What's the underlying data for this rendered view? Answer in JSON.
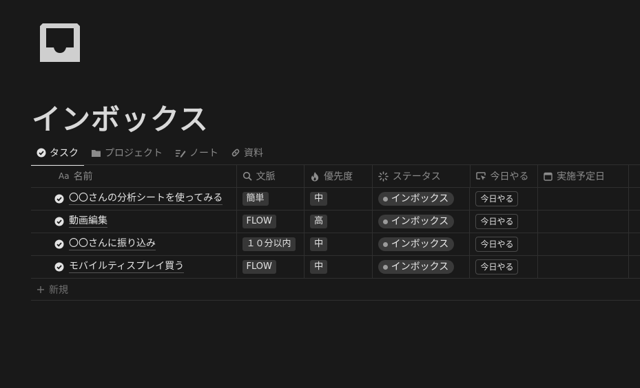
{
  "page": {
    "icon": "inbox-tray-icon",
    "title": "インボックス"
  },
  "tabs": [
    {
      "label": "タスク",
      "icon": "check-circle-icon",
      "active": true
    },
    {
      "label": "プロジェクト",
      "icon": "folder-icon",
      "active": false
    },
    {
      "label": "ノート",
      "icon": "note-pen-icon",
      "active": false
    },
    {
      "label": "資料",
      "icon": "link-icon",
      "active": false
    }
  ],
  "table": {
    "headers": {
      "name_prefix": "Aa",
      "name": "名前",
      "bunmyaku": "文脈",
      "priority": "優先度",
      "status": "ステータス",
      "today": "今日やる",
      "date": "実施予定日"
    },
    "rows": [
      {
        "name": "〇〇さんの分析シートを使ってみる",
        "bunmyaku": "簡単",
        "priority": "中",
        "status": "インボックス",
        "today": "今日やる",
        "date": ""
      },
      {
        "name": "動画編集",
        "bunmyaku": "FLOW",
        "priority": "高",
        "status": "インボックス",
        "today": "今日やる",
        "date": ""
      },
      {
        "name": "〇〇さんに振り込み",
        "bunmyaku": "１０分以内",
        "priority": "中",
        "status": "インボックス",
        "today": "今日やる",
        "date": ""
      },
      {
        "name": "モバイルティスプレイ買う",
        "bunmyaku": "FLOW",
        "priority": "中",
        "status": "インボックス",
        "today": "今日やる",
        "date": ""
      }
    ],
    "new_label": "新規"
  },
  "colors": {
    "background": "#191919",
    "tag_bg": "#373737",
    "status_pill_bg": "#3a3a3a",
    "border": "#2f2f2f"
  }
}
